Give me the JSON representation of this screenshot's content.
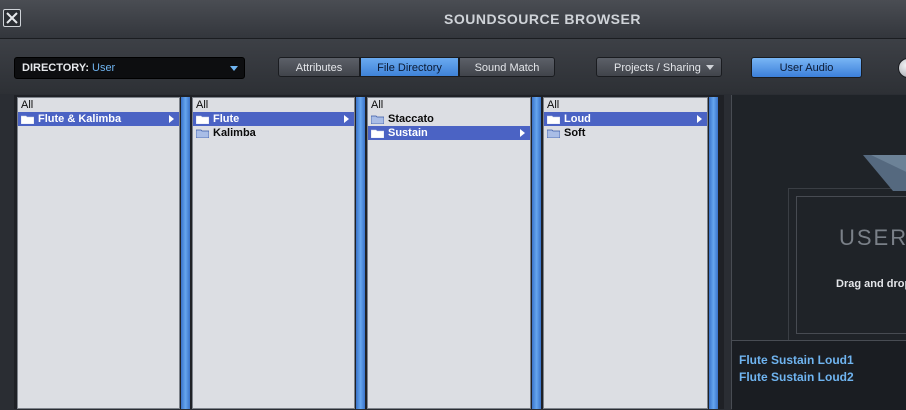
{
  "app": {
    "title": "SOUNDSOURCE BROWSER"
  },
  "directory": {
    "label": "DIRECTORY:",
    "value": "User"
  },
  "tabs": [
    {
      "label": "Attributes",
      "active": false
    },
    {
      "label": "File Directory",
      "active": true
    },
    {
      "label": "Sound Match",
      "active": false
    }
  ],
  "projects_button": "Projects / Sharing",
  "user_audio_button": "User Audio",
  "colors": {
    "accent": "#4a90e2",
    "selection": "#4b63c4",
    "link": "#6fb4f0"
  },
  "columns": [
    {
      "all": "All",
      "items": [
        {
          "label": "Flute & Kalimba",
          "selected": true
        }
      ]
    },
    {
      "all": "All",
      "items": [
        {
          "label": "Flute",
          "selected": true
        },
        {
          "label": "Kalimba",
          "selected": false
        }
      ]
    },
    {
      "all": "All",
      "items": [
        {
          "label": "Staccato",
          "selected": false
        },
        {
          "label": "Sustain",
          "selected": true
        }
      ]
    },
    {
      "all": "All",
      "items": [
        {
          "label": "Loud",
          "selected": true
        },
        {
          "label": "Soft",
          "selected": false
        }
      ]
    }
  ],
  "drop_zone": {
    "big_text": "USER",
    "hint": "Drag and drop"
  },
  "files": [
    "Flute Sustain Loud1",
    "Flute Sustain Loud2"
  ],
  "icons": {
    "close": "close-icon",
    "folder": "folder-icon",
    "expand": "expand-arrow-icon"
  }
}
